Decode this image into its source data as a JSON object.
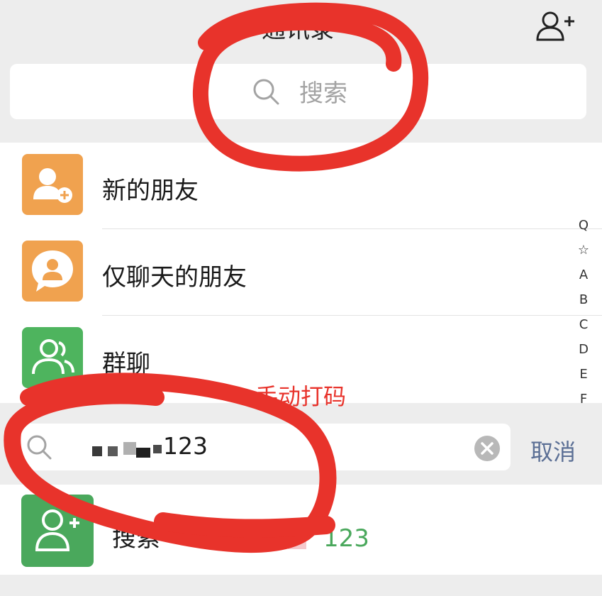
{
  "header": {
    "title": "通讯录",
    "add_icon": "add-contact-icon"
  },
  "search": {
    "placeholder": "搜索",
    "icon": "search-icon"
  },
  "contacts": {
    "items": [
      {
        "label": "新的朋友",
        "icon": "new-friend-icon",
        "color": "#f0a24f"
      },
      {
        "label": "仅聊天的朋友",
        "icon": "chat-only-friend-icon",
        "color": "#f0a24f"
      },
      {
        "label": "群聊",
        "icon": "group-chat-icon",
        "color": "#4eb45e"
      }
    ]
  },
  "alphabet_index": [
    "Q",
    "☆",
    "A",
    "B",
    "C",
    "D",
    "E",
    "F"
  ],
  "annotation": "手动打码",
  "search_active": {
    "value": "123",
    "cancel_label": "取消",
    "clear_icon": "clear-icon"
  },
  "result": {
    "prefix": "搜索",
    "highlight": "123",
    "icon": "add-friend-icon",
    "color": "#4aa85c"
  },
  "colors": {
    "annotation": "#e8332b",
    "cancel": "#5b6f95",
    "orange_tile": "#f0a24f",
    "green_tile": "#4eb45e"
  }
}
